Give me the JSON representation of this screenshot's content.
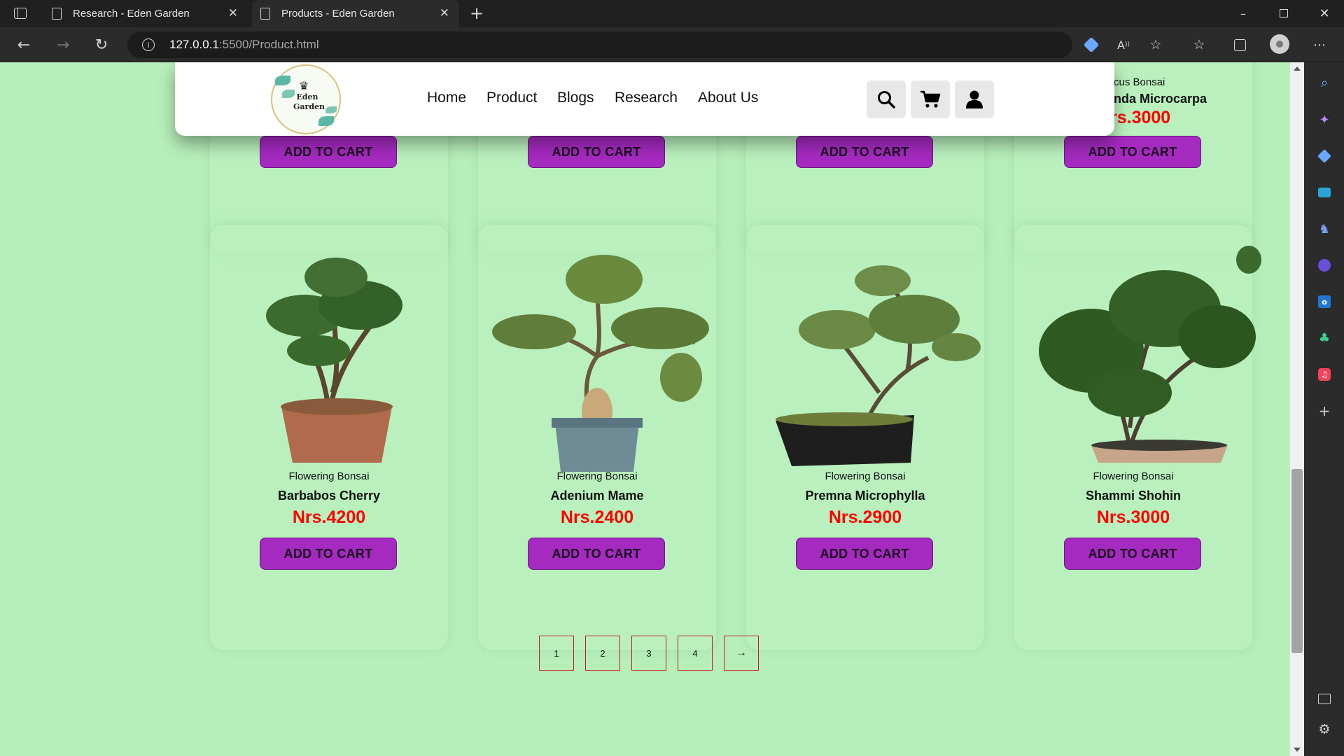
{
  "browser": {
    "tabs": [
      {
        "title": "Research - Eden Garden"
      },
      {
        "title": "Products - Eden Garden"
      }
    ],
    "url_host": "127.0.0.1",
    "url_rest": ":5500/Product.html"
  },
  "nav": {
    "logo_text_1": "Eden",
    "logo_text_2": "Garden",
    "links": [
      "Home",
      "Product",
      "Blogs",
      "Research",
      "About Us"
    ]
  },
  "top_row": [
    {
      "button": "ADD TO CART"
    },
    {
      "button": "ADD TO CART"
    },
    {
      "button": "ADD TO CART"
    },
    {
      "category_partial": "cus Bonsai",
      "name_partial": "anda Microcarpa",
      "price_partial": "rs.3000",
      "button": "ADD TO CART"
    }
  ],
  "products": [
    {
      "category": "Flowering Bonsai",
      "name": "Barbabos Cherry",
      "price": "Nrs.4200",
      "button": "ADD TO CART"
    },
    {
      "category": "Flowering Bonsai",
      "name": "Adenium Mame",
      "price": "Nrs.2400",
      "button": "ADD TO CART"
    },
    {
      "category": "Flowering Bonsai",
      "name": "Premna Microphylla",
      "price": "Nrs.2900",
      "button": "ADD TO CART"
    },
    {
      "category": "Flowering Bonsai",
      "name": "Shammi Shohin",
      "price": "Nrs.3000",
      "button": "ADD TO CART"
    }
  ],
  "pagination": [
    "1",
    "2",
    "3",
    "4",
    "→"
  ]
}
